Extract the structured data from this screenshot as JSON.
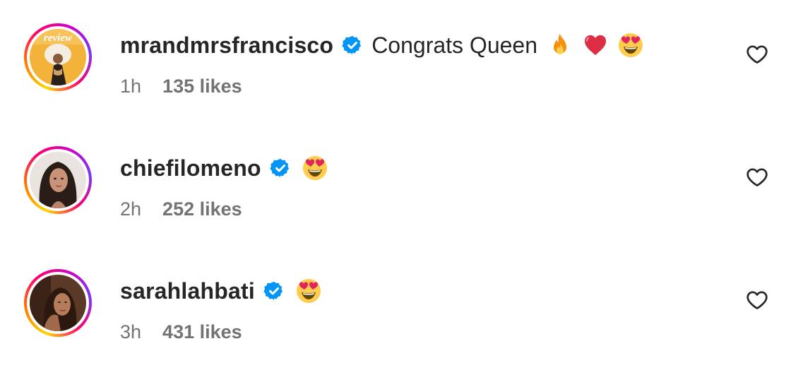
{
  "comments": [
    {
      "username": "mrandmrsfrancisco",
      "verified": true,
      "text": "Congrats Queen",
      "emojis": [
        "fire-emoji",
        "red-heart-emoji",
        "heart-eyes-emoji"
      ],
      "time": "1h",
      "likes": "135 likes",
      "avatar_text": "review"
    },
    {
      "username": "chiefilomeno",
      "verified": true,
      "text": "",
      "emojis": [
        "heart-eyes-emoji"
      ],
      "time": "2h",
      "likes": "252 likes"
    },
    {
      "username": "sarahlahbati",
      "verified": true,
      "text": "",
      "emojis": [
        "heart-eyes-emoji"
      ],
      "time": "3h",
      "likes": "431 likes"
    }
  ],
  "colors": {
    "verified_blue": "#0095f6",
    "text_primary": "#262626",
    "text_secondary": "#737373"
  }
}
